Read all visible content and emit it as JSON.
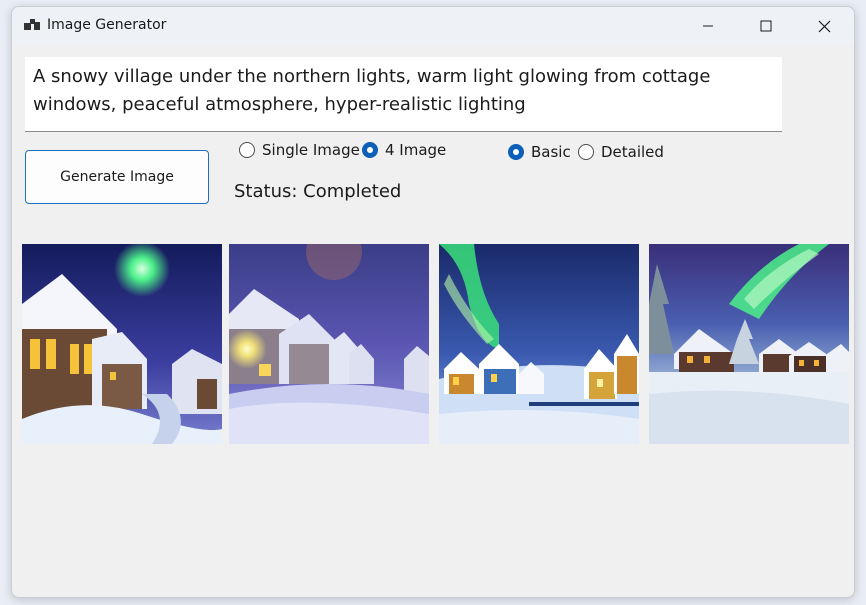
{
  "window": {
    "title": "Image Generator",
    "app_icon": "app-icon"
  },
  "prompt": {
    "value": "A snowy village under the northern lights, warm light glowing from cottage windows, peaceful atmosphere, hyper-realistic lighting"
  },
  "generate_button": {
    "label": "Generate Image"
  },
  "image_count": {
    "options": [
      {
        "label": "Single Image",
        "checked": false
      },
      {
        "label": "4 Image",
        "checked": true
      }
    ]
  },
  "detail_level": {
    "options": [
      {
        "label": "Basic",
        "checked": true
      },
      {
        "label": "Detailed",
        "checked": false
      }
    ]
  },
  "status": {
    "text": "Status: Completed"
  },
  "colors": {
    "accent": "#0d5fb8",
    "button_border": "#1d6fbf",
    "background": "#f0f0f0"
  },
  "images": [
    {
      "name": "generated-image-1"
    },
    {
      "name": "generated-image-2"
    },
    {
      "name": "generated-image-3"
    },
    {
      "name": "generated-image-4"
    }
  ]
}
